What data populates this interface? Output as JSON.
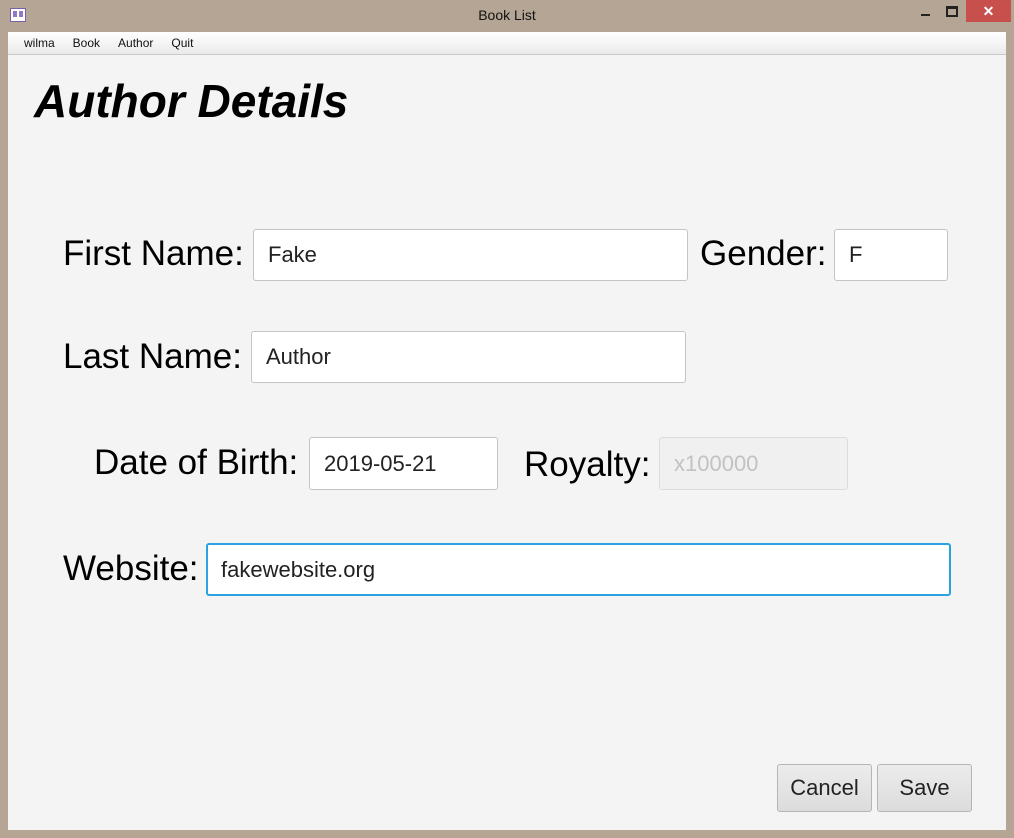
{
  "window": {
    "title": "Book List"
  },
  "menu": [
    "wilma",
    "Book",
    "Author",
    "Quit"
  ],
  "page": {
    "heading": "Author Details"
  },
  "form": {
    "first_name": {
      "label": "First Name:",
      "value": "Fake"
    },
    "gender": {
      "label": "Gender:",
      "value": "F"
    },
    "last_name": {
      "label": "Last Name:",
      "value": "Author"
    },
    "date_of_birth": {
      "label": "Date of Birth:",
      "value": "2019-05-21"
    },
    "royalty": {
      "label": "Royalty:",
      "placeholder": "x100000",
      "disabled": true
    },
    "website": {
      "label": "Website:",
      "value": "fakewebsite.org"
    }
  },
  "buttons": {
    "cancel": "Cancel",
    "save": "Save"
  },
  "colors": {
    "titlebar": "#b5a595",
    "close": "#c7504c",
    "focus": "#2aa3e0",
    "background": "#f4f4f4"
  },
  "icons": [
    "app-icon",
    "minimize-icon",
    "maximize-icon",
    "close-icon"
  ]
}
